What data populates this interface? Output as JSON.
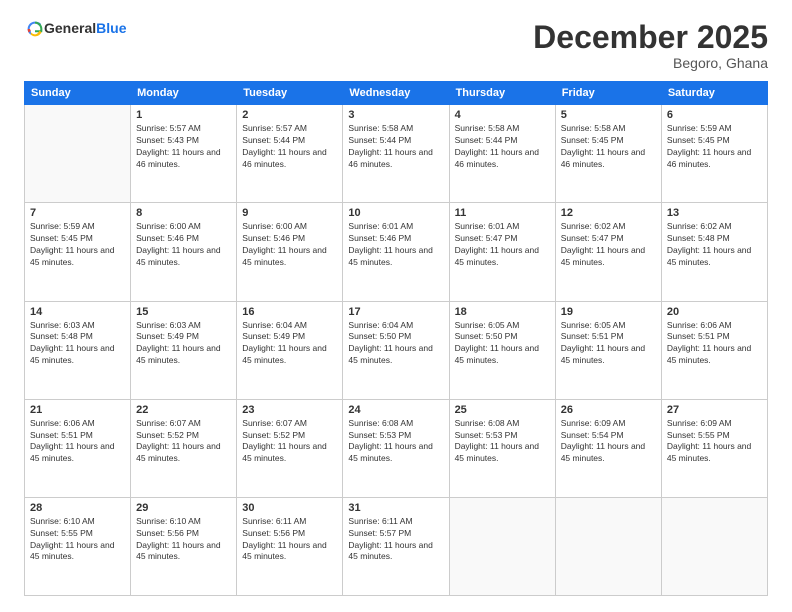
{
  "header": {
    "logo": {
      "general": "General",
      "blue": "Blue"
    },
    "title": "December 2025",
    "location": "Begoro, Ghana"
  },
  "weekdays": [
    "Sunday",
    "Monday",
    "Tuesday",
    "Wednesday",
    "Thursday",
    "Friday",
    "Saturday"
  ],
  "weeks": [
    [
      {
        "day": null
      },
      {
        "day": 1,
        "sunrise": "5:57 AM",
        "sunset": "5:43 PM",
        "daylight": "11 hours and 46 minutes."
      },
      {
        "day": 2,
        "sunrise": "5:57 AM",
        "sunset": "5:44 PM",
        "daylight": "11 hours and 46 minutes."
      },
      {
        "day": 3,
        "sunrise": "5:58 AM",
        "sunset": "5:44 PM",
        "daylight": "11 hours and 46 minutes."
      },
      {
        "day": 4,
        "sunrise": "5:58 AM",
        "sunset": "5:44 PM",
        "daylight": "11 hours and 46 minutes."
      },
      {
        "day": 5,
        "sunrise": "5:58 AM",
        "sunset": "5:45 PM",
        "daylight": "11 hours and 46 minutes."
      },
      {
        "day": 6,
        "sunrise": "5:59 AM",
        "sunset": "5:45 PM",
        "daylight": "11 hours and 46 minutes."
      }
    ],
    [
      {
        "day": 7,
        "sunrise": "5:59 AM",
        "sunset": "5:45 PM",
        "daylight": "11 hours and 45 minutes."
      },
      {
        "day": 8,
        "sunrise": "6:00 AM",
        "sunset": "5:46 PM",
        "daylight": "11 hours and 45 minutes."
      },
      {
        "day": 9,
        "sunrise": "6:00 AM",
        "sunset": "5:46 PM",
        "daylight": "11 hours and 45 minutes."
      },
      {
        "day": 10,
        "sunrise": "6:01 AM",
        "sunset": "5:46 PM",
        "daylight": "11 hours and 45 minutes."
      },
      {
        "day": 11,
        "sunrise": "6:01 AM",
        "sunset": "5:47 PM",
        "daylight": "11 hours and 45 minutes."
      },
      {
        "day": 12,
        "sunrise": "6:02 AM",
        "sunset": "5:47 PM",
        "daylight": "11 hours and 45 minutes."
      },
      {
        "day": 13,
        "sunrise": "6:02 AM",
        "sunset": "5:48 PM",
        "daylight": "11 hours and 45 minutes."
      }
    ],
    [
      {
        "day": 14,
        "sunrise": "6:03 AM",
        "sunset": "5:48 PM",
        "daylight": "11 hours and 45 minutes."
      },
      {
        "day": 15,
        "sunrise": "6:03 AM",
        "sunset": "5:49 PM",
        "daylight": "11 hours and 45 minutes."
      },
      {
        "day": 16,
        "sunrise": "6:04 AM",
        "sunset": "5:49 PM",
        "daylight": "11 hours and 45 minutes."
      },
      {
        "day": 17,
        "sunrise": "6:04 AM",
        "sunset": "5:50 PM",
        "daylight": "11 hours and 45 minutes."
      },
      {
        "day": 18,
        "sunrise": "6:05 AM",
        "sunset": "5:50 PM",
        "daylight": "11 hours and 45 minutes."
      },
      {
        "day": 19,
        "sunrise": "6:05 AM",
        "sunset": "5:51 PM",
        "daylight": "11 hours and 45 minutes."
      },
      {
        "day": 20,
        "sunrise": "6:06 AM",
        "sunset": "5:51 PM",
        "daylight": "11 hours and 45 minutes."
      }
    ],
    [
      {
        "day": 21,
        "sunrise": "6:06 AM",
        "sunset": "5:51 PM",
        "daylight": "11 hours and 45 minutes."
      },
      {
        "day": 22,
        "sunrise": "6:07 AM",
        "sunset": "5:52 PM",
        "daylight": "11 hours and 45 minutes."
      },
      {
        "day": 23,
        "sunrise": "6:07 AM",
        "sunset": "5:52 PM",
        "daylight": "11 hours and 45 minutes."
      },
      {
        "day": 24,
        "sunrise": "6:08 AM",
        "sunset": "5:53 PM",
        "daylight": "11 hours and 45 minutes."
      },
      {
        "day": 25,
        "sunrise": "6:08 AM",
        "sunset": "5:53 PM",
        "daylight": "11 hours and 45 minutes."
      },
      {
        "day": 26,
        "sunrise": "6:09 AM",
        "sunset": "5:54 PM",
        "daylight": "11 hours and 45 minutes."
      },
      {
        "day": 27,
        "sunrise": "6:09 AM",
        "sunset": "5:55 PM",
        "daylight": "11 hours and 45 minutes."
      }
    ],
    [
      {
        "day": 28,
        "sunrise": "6:10 AM",
        "sunset": "5:55 PM",
        "daylight": "11 hours and 45 minutes."
      },
      {
        "day": 29,
        "sunrise": "6:10 AM",
        "sunset": "5:56 PM",
        "daylight": "11 hours and 45 minutes."
      },
      {
        "day": 30,
        "sunrise": "6:11 AM",
        "sunset": "5:56 PM",
        "daylight": "11 hours and 45 minutes."
      },
      {
        "day": 31,
        "sunrise": "6:11 AM",
        "sunset": "5:57 PM",
        "daylight": "11 hours and 45 minutes."
      },
      {
        "day": null
      },
      {
        "day": null
      },
      {
        "day": null
      }
    ]
  ],
  "labels": {
    "sunrise": "Sunrise:",
    "sunset": "Sunset:",
    "daylight": "Daylight:"
  }
}
